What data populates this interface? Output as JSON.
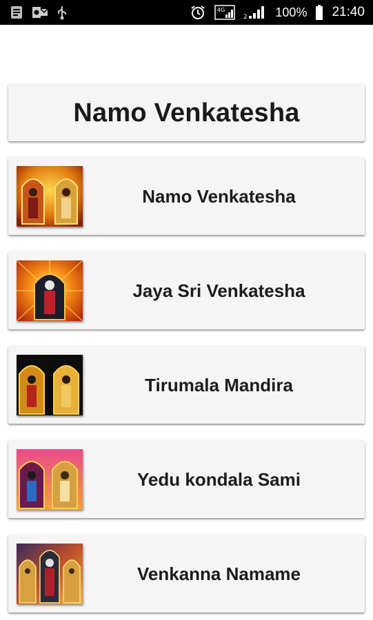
{
  "status_bar": {
    "left_icons": [
      "notification-icon",
      "outlook-icon",
      "usb-icon"
    ],
    "right_icons": [
      "alarm-icon",
      "signal-4g-icon",
      "signal-bars-icon",
      "battery-icon"
    ],
    "battery": "100%",
    "time": "21:40"
  },
  "header": {
    "title": "Namo Venkatesha"
  },
  "items": [
    {
      "label": "Namo Venkatesha",
      "thumb": "deity-image-1"
    },
    {
      "label": "Jaya Sri Venkatesha",
      "thumb": "deity-image-2"
    },
    {
      "label": "Tirumala Mandira",
      "thumb": "deity-image-3"
    },
    {
      "label": "Yedu kondala Sami",
      "thumb": "deity-image-4"
    },
    {
      "label": "Venkanna Namame",
      "thumb": "deity-image-5"
    }
  ],
  "colors": {
    "status_bar_bg": "#000000",
    "card_bg": "#f5f5f5",
    "text": "#1a1a1a"
  }
}
